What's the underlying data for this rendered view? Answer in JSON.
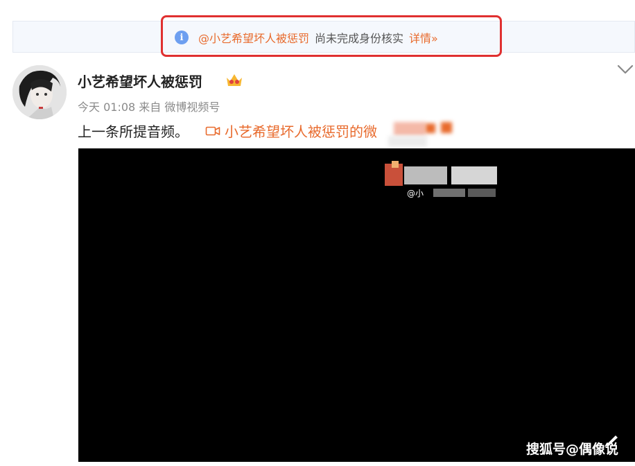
{
  "notice": {
    "user": "@小艺希望坏人被惩罚",
    "text": "尚未完成身份核实",
    "link": "详情»"
  },
  "post": {
    "username": "小艺希望坏人被惩罚",
    "meta": "今天 01:08 来自 微博视频号",
    "body": "上一条所提音频。",
    "video_link": "小艺希望坏人被惩罚的微",
    "icons": {
      "info": "info-icon",
      "crown": "vip-crown-icon",
      "video": "video-camera-icon",
      "menu": "chevron-down-icon"
    }
  },
  "video": {
    "watermark_handle": "@小",
    "source_watermark": "搜狐号@偶像说"
  },
  "colors": {
    "accent": "#e86a2c",
    "highlight_border": "#e03030",
    "info_blue": "#6d9ff0"
  }
}
